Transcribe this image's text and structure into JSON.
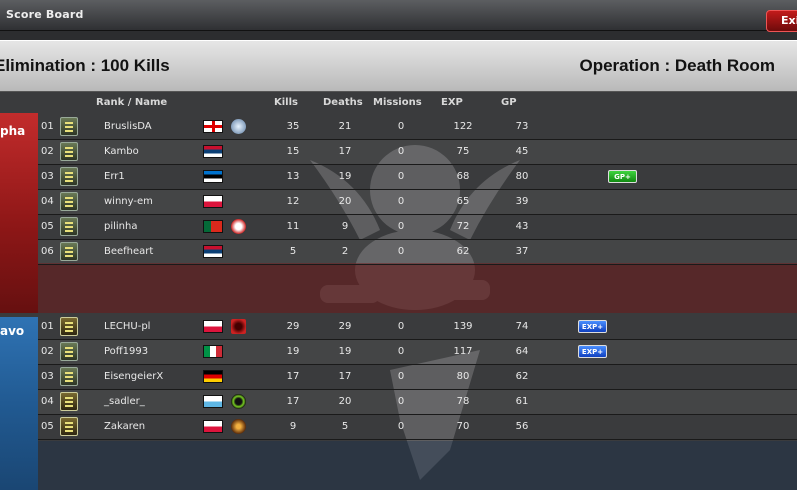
{
  "window": {
    "title": "Score Board",
    "exit_label": "Exi"
  },
  "header": {
    "mode": "Elimination : 100 Kills",
    "operation": "Operation : Death Room"
  },
  "columns": {
    "rank_name": "Rank / Name",
    "kills": "Kills",
    "deaths": "Deaths",
    "missions": "Missions",
    "exp": "EXP",
    "gp": "GP"
  },
  "teams": [
    {
      "label": "pha",
      "players": [
        {
          "pos": "01",
          "name": "BruslisDA",
          "kills": "35",
          "deaths": "21",
          "missions": "0",
          "exp": "122",
          "gp": "73",
          "flag": "georgia",
          "clan": "wolf",
          "bonus": ""
        },
        {
          "pos": "02",
          "name": "Kambo",
          "kills": "15",
          "deaths": "17",
          "missions": "0",
          "exp": "75",
          "gp": "45",
          "flag": "serbia",
          "clan": "",
          "bonus": ""
        },
        {
          "pos": "03",
          "name": "Err1",
          "kills": "13",
          "deaths": "19",
          "missions": "0",
          "exp": "68",
          "gp": "80",
          "flag": "estonia",
          "clan": "",
          "bonus": "GP+"
        },
        {
          "pos": "04",
          "name": "winny-em",
          "kills": "12",
          "deaths": "20",
          "missions": "0",
          "exp": "65",
          "gp": "39",
          "flag": "poland",
          "clan": "",
          "bonus": ""
        },
        {
          "pos": "05",
          "name": "pilinha",
          "kills": "11",
          "deaths": "9",
          "missions": "0",
          "exp": "72",
          "gp": "43",
          "flag": "portugal",
          "clan": "red-emblem",
          "bonus": ""
        },
        {
          "pos": "06",
          "name": "Beefheart",
          "kills": "5",
          "deaths": "2",
          "missions": "0",
          "exp": "62",
          "gp": "37",
          "flag": "serbia",
          "clan": "",
          "bonus": ""
        }
      ]
    },
    {
      "label": "avo",
      "players": [
        {
          "pos": "01",
          "name": "LECHU-pl",
          "kills": "29",
          "deaths": "29",
          "missions": "0",
          "exp": "139",
          "gp": "74",
          "flag": "poland",
          "clan": "red-bird",
          "bonus": "EXP+"
        },
        {
          "pos": "02",
          "name": "Poff1993",
          "kills": "19",
          "deaths": "19",
          "missions": "0",
          "exp": "117",
          "gp": "64",
          "flag": "italy",
          "clan": "",
          "bonus": "EXP+"
        },
        {
          "pos": "03",
          "name": "EisengeierX",
          "kills": "17",
          "deaths": "17",
          "missions": "0",
          "exp": "80",
          "gp": "62",
          "flag": "germany",
          "clan": "",
          "bonus": ""
        },
        {
          "pos": "04",
          "name": "_sadler_",
          "kills": "17",
          "deaths": "20",
          "missions": "0",
          "exp": "78",
          "gp": "61",
          "flag": "san-marino",
          "clan": "green-target",
          "bonus": ""
        },
        {
          "pos": "05",
          "name": "Zakaren",
          "kills": "9",
          "deaths": "5",
          "missions": "0",
          "exp": "70",
          "gp": "56",
          "flag": "poland",
          "clan": "brown-emblem",
          "bonus": ""
        }
      ]
    }
  ],
  "colors": {
    "alpha": "#c22c2c",
    "bravo": "#2f73b4",
    "gp_bonus": "#2fbf2f",
    "exp_bonus": "#2f6fe0"
  }
}
